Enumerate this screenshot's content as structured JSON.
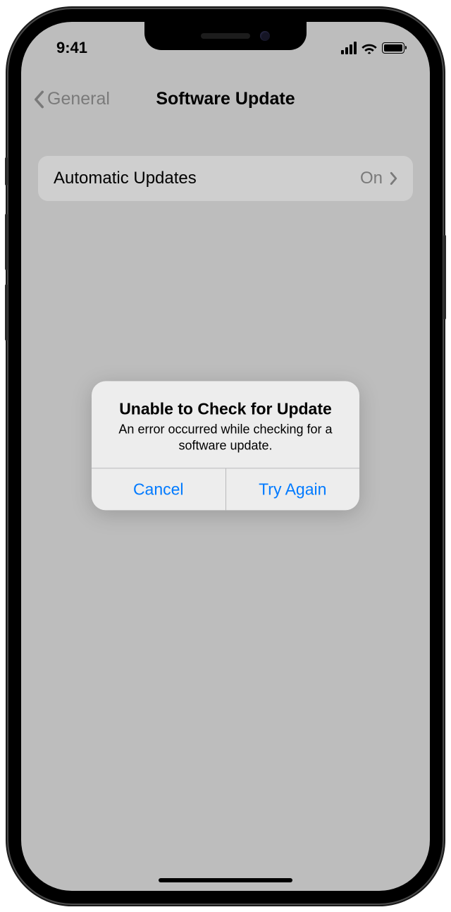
{
  "status_bar": {
    "time": "9:41"
  },
  "nav": {
    "back_label": "General",
    "title": "Software Update"
  },
  "rows": {
    "automatic_updates": {
      "label": "Automatic Updates",
      "value": "On"
    }
  },
  "alert": {
    "title": "Unable to Check for Update",
    "message": "An error occurred while checking for a software update.",
    "cancel": "Cancel",
    "try_again": "Try Again"
  }
}
